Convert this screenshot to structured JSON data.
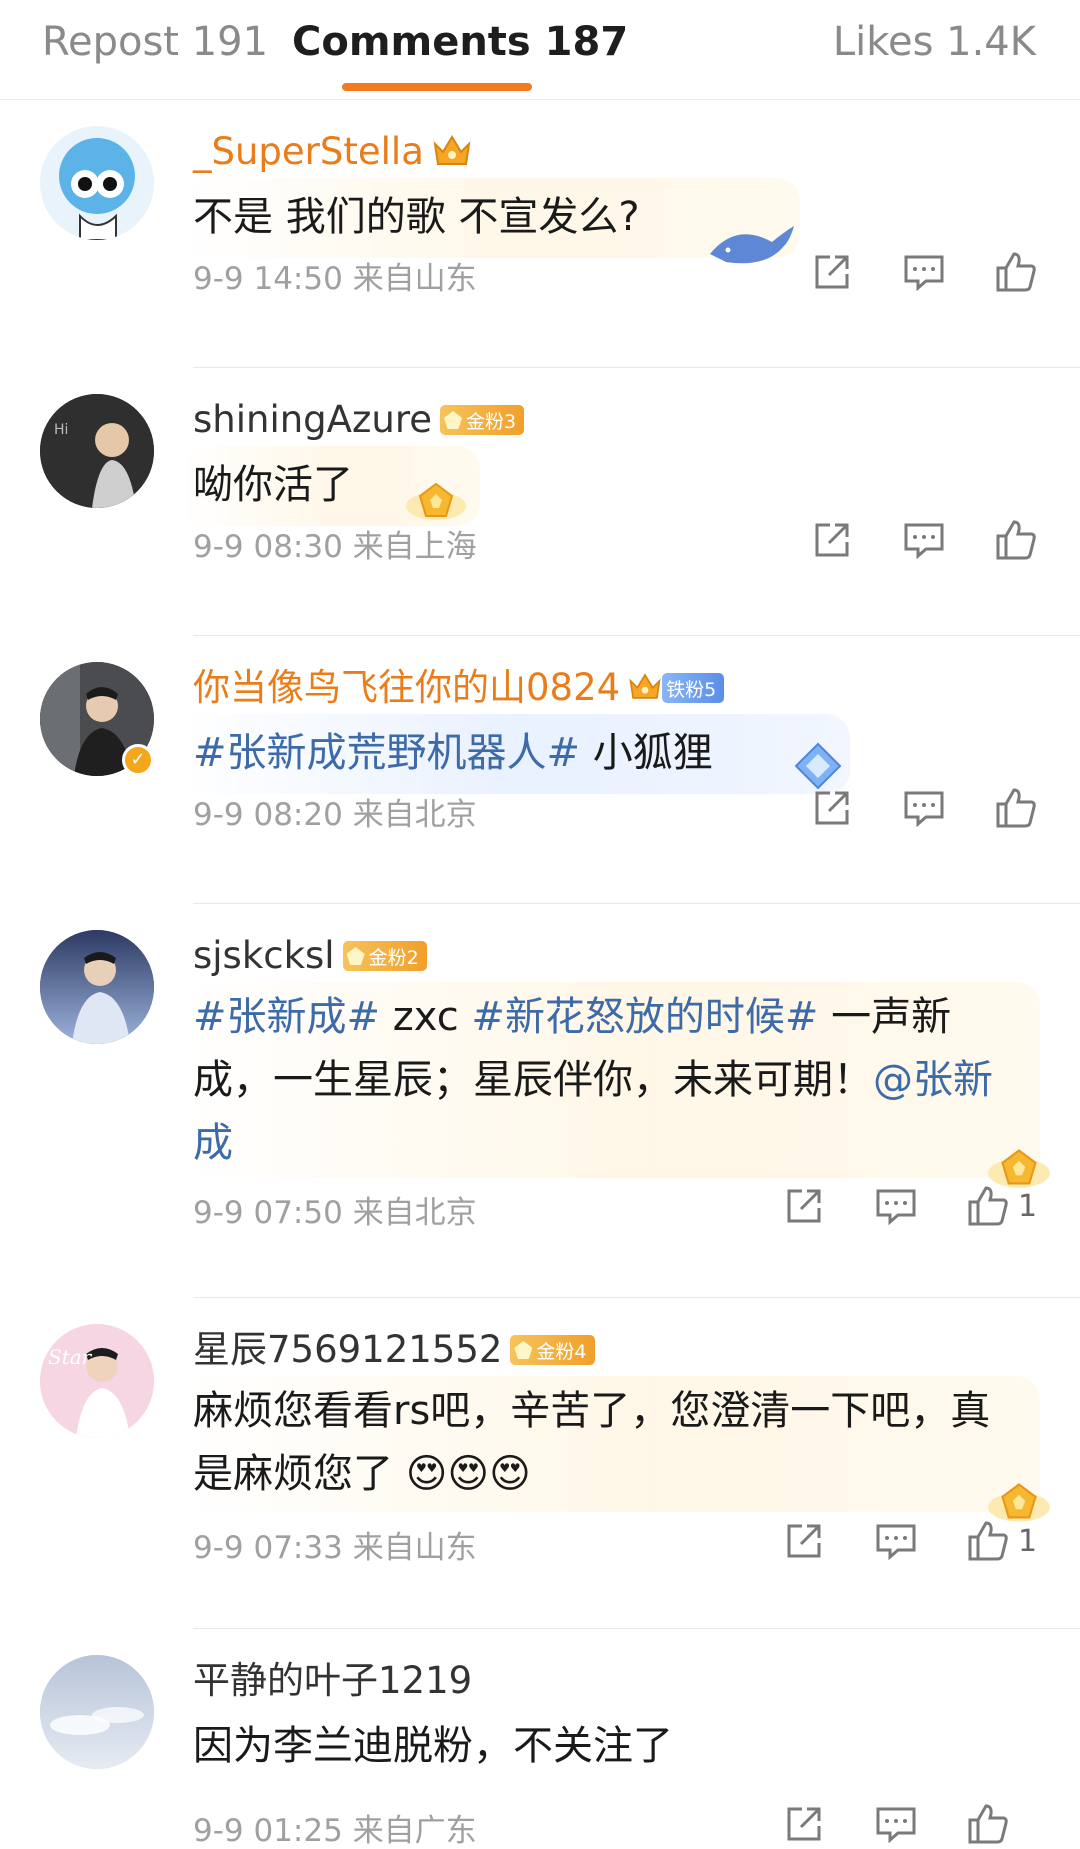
{
  "tabs": {
    "reposts": "Repost 191",
    "comments": "Comments 187",
    "likes": "Likes 1.4K"
  },
  "icons": [
    "crown-icon",
    "share-icon",
    "reply-icon",
    "like-icon",
    "verified-icon",
    "fan-badge-icon"
  ],
  "comments": [
    {
      "username": "_SuperStella",
      "text": "不是 我们的歌 不宣发么?",
      "time": "9-9 14:50",
      "location": "来自山东"
    },
    {
      "username": "shiningAzure",
      "badge": "金粉3",
      "text": "呦你活了",
      "time": "9-9 08:30",
      "location": "来自上海"
    },
    {
      "username": "你当像鸟飞往你的山0824",
      "badge": "铁粉5",
      "topic": "#张新成荒野机器人#",
      "text": " 小狐狸",
      "time": "9-9 08:20",
      "location": "来自北京"
    },
    {
      "username": "sjskcksl",
      "badge": "金粉2",
      "topic1": "#张新成#",
      "text1": " zxc ",
      "topic2": "#新花怒放的时候#",
      "text2": " 一声新成，一生星辰；星辰伴你，未来可期！",
      "mention": "@张新成",
      "time": "9-9 07:50",
      "location": "来自北京",
      "likes": "1"
    },
    {
      "username": "星辰7569121552",
      "badge": "金粉4",
      "text": "麻烦您看看rs吧，辛苦了，您澄清一下吧，真是麻烦您了",
      "time": "9-9 07:33",
      "location": "来自山东",
      "likes": "1"
    },
    {
      "username": "平静的叶子1219",
      "text": "因为李兰迪脱粉，不关注了",
      "time": "9-9 01:25",
      "location": "来自广东"
    }
  ]
}
